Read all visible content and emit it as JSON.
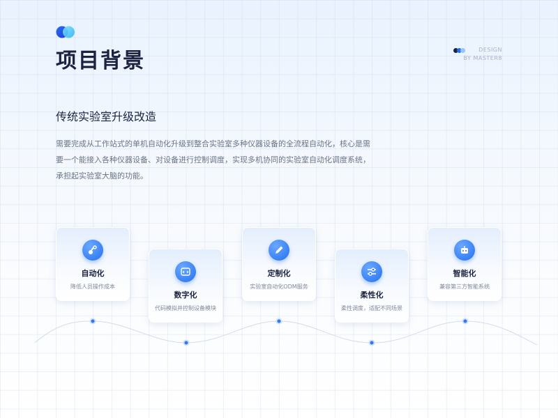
{
  "header": {
    "title": "项目背景",
    "designer_line1": "DESIGN",
    "designer_line2": "BY MASTER8"
  },
  "section": {
    "subtitle": "传统实验室升级改造",
    "description": "需要完成从工作站式的单机自动化升级到整合实验室多种仪器设备的全流程自动化，核心是需要一个能接入各种仪器设备、对设备进行控制调度，实现多机协同的实验室自动化调度系统，承担起实验室大脑的功能。"
  },
  "cards": [
    {
      "title": "自动化",
      "desc": "降低人员操作成本",
      "icon": "robot-arm-icon"
    },
    {
      "title": "数字化",
      "desc": "代码模拟并控制设备模块",
      "icon": "code-window-icon"
    },
    {
      "title": "定制化",
      "desc": "实验室自动化ODM服务",
      "icon": "pencil-icon"
    },
    {
      "title": "柔性化",
      "desc": "柔性调度，适配不同场景",
      "icon": "sliders-icon"
    },
    {
      "title": "智能化",
      "desc": "兼容第三方智能系统",
      "icon": "robot-icon"
    }
  ],
  "colors": {
    "accent": "#2470f0",
    "title": "#1c2340",
    "text": "#6b7486"
  }
}
